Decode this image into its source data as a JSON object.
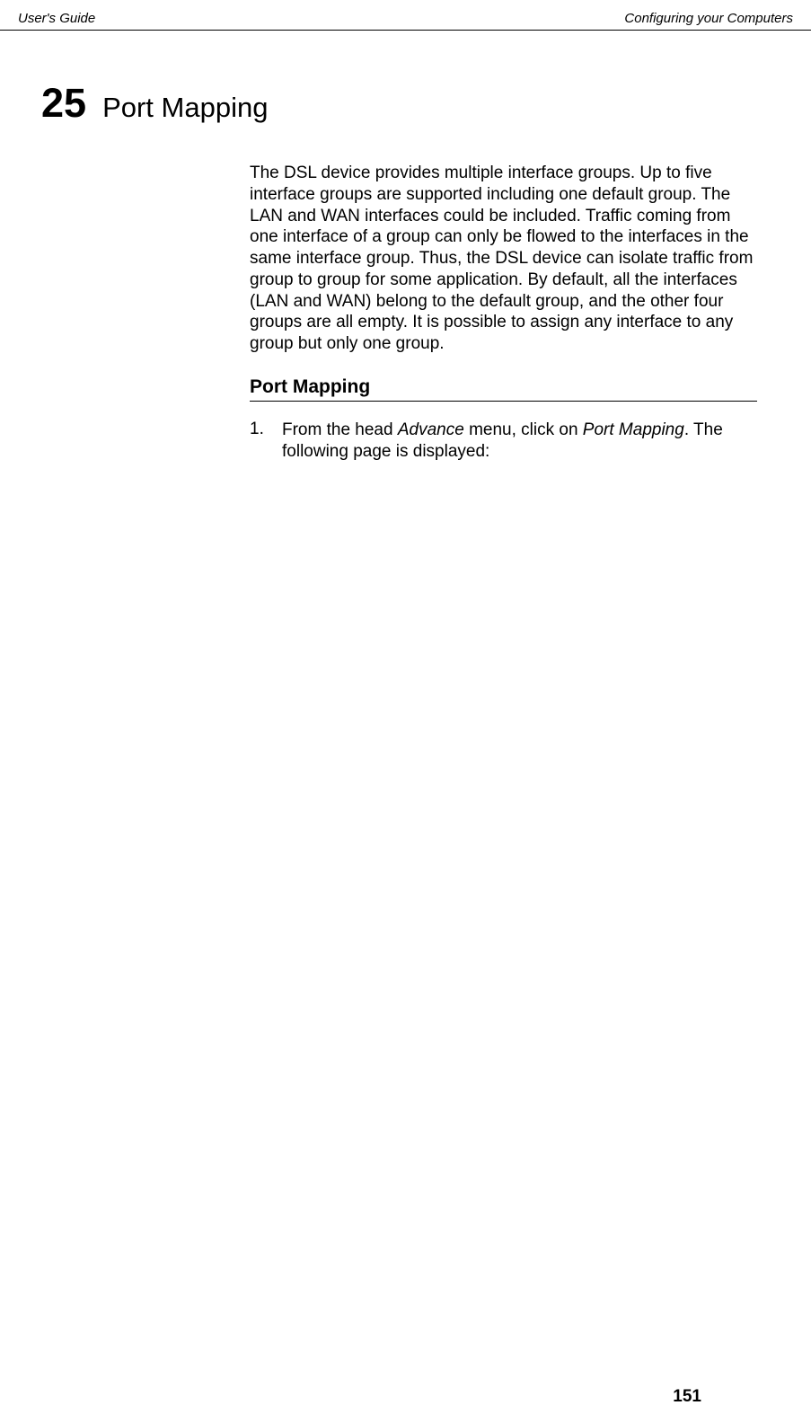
{
  "header": {
    "left": "User's Guide",
    "right": "Configuring your Computers"
  },
  "chapter": {
    "number": "25",
    "title": "Port Mapping"
  },
  "intro": "The DSL device provides multiple interface groups. Up to five interface groups are supported including one default group. The LAN and WAN interfaces could be included. Traffic coming from one interface of a group can only be flowed to the interfaces in the same interface group. Thus, the DSL device can isolate traffic from group to group for some application. By default, all the interfaces (LAN and WAN) belong to the default group, and the other four groups are all empty. It is possible to assign any interface to any group but only one group.",
  "section_heading": "Port Mapping",
  "list": {
    "num": "1.",
    "text_part1": "From the head ",
    "italic1": "Advance",
    "text_part2": " menu, click on ",
    "italic2": "Port Mapping",
    "text_part3": ". The following page is displayed:"
  },
  "page_number": "151"
}
